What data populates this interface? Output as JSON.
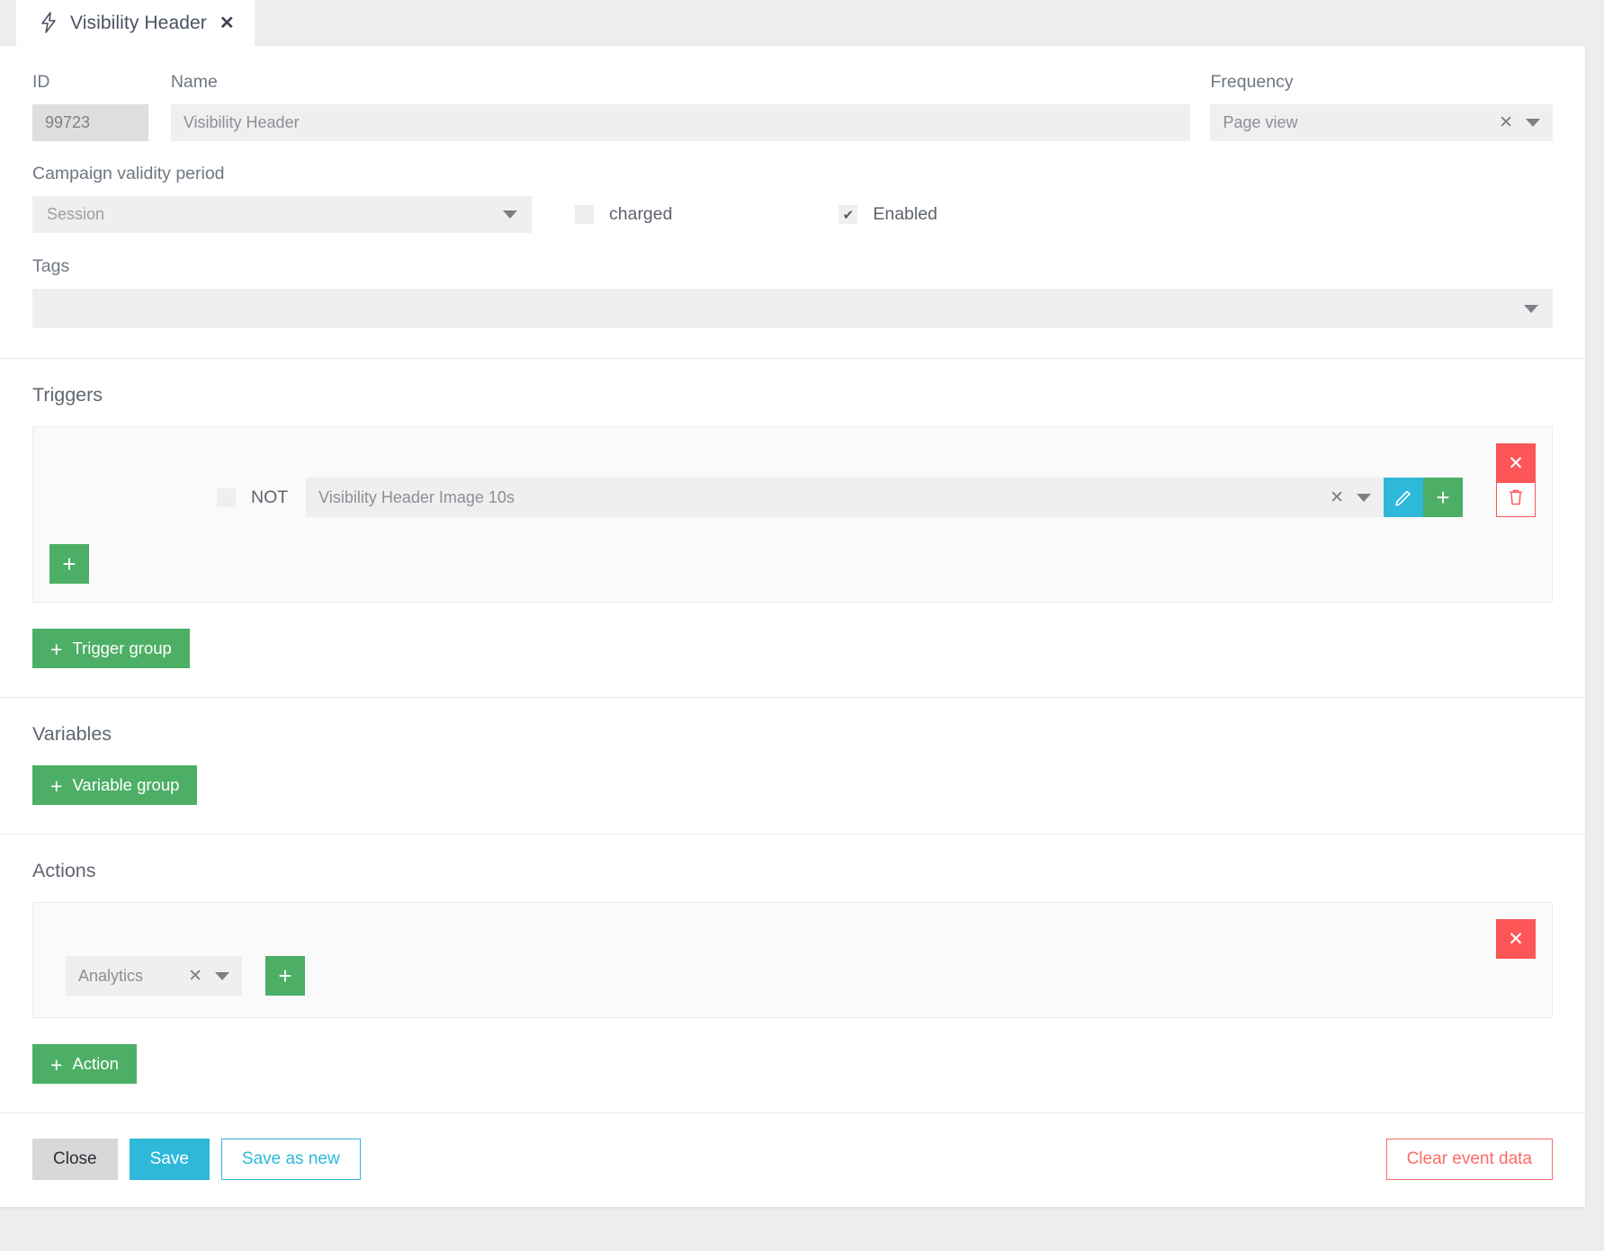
{
  "tab": {
    "icon": "lightning-bolt-icon",
    "title": "Visibility Header",
    "close": "✕"
  },
  "form": {
    "id_label": "ID",
    "id_value": "99723",
    "name_label": "Name",
    "name_value": "Visibility Header",
    "frequency_label": "Frequency",
    "frequency_value": "Page view",
    "validity_label": "Campaign validity period",
    "validity_value": "Session",
    "charged_label": "charged",
    "charged_checked": "",
    "enabled_label": "Enabled",
    "enabled_checked": "✔",
    "tags_label": "Tags",
    "tags_value": ""
  },
  "triggers": {
    "title": "Triggers",
    "group_close": "✕",
    "not_label": "NOT",
    "not_checked": "",
    "trigger_value": "Visibility Header Image 10s",
    "clear": "✕",
    "edit_icon": "pencil-icon",
    "add_icon": "plus-icon",
    "delete_icon": "trash-icon",
    "add_trigger_plus": "+",
    "add_group_plus": "+",
    "add_group_label": "Trigger group"
  },
  "variables": {
    "title": "Variables",
    "add_group_plus": "+",
    "add_group_label": "Variable group"
  },
  "actions": {
    "title": "Actions",
    "group_close": "✕",
    "action_value": "Analytics",
    "clear": "✕",
    "add_plus": "+",
    "add_action_plus": "+",
    "add_action_label": "Action"
  },
  "footer": {
    "close_label": "Close",
    "save_label": "Save",
    "save_as_new_label": "Save as new",
    "clear_event_data_label": "Clear event data"
  },
  "colors": {
    "green": "#4caf65",
    "blue": "#2eb8da",
    "red": "#fc5656",
    "red_outline": "#fc6b65",
    "field_bg": "#efefef",
    "page_bg": "#ededed"
  }
}
